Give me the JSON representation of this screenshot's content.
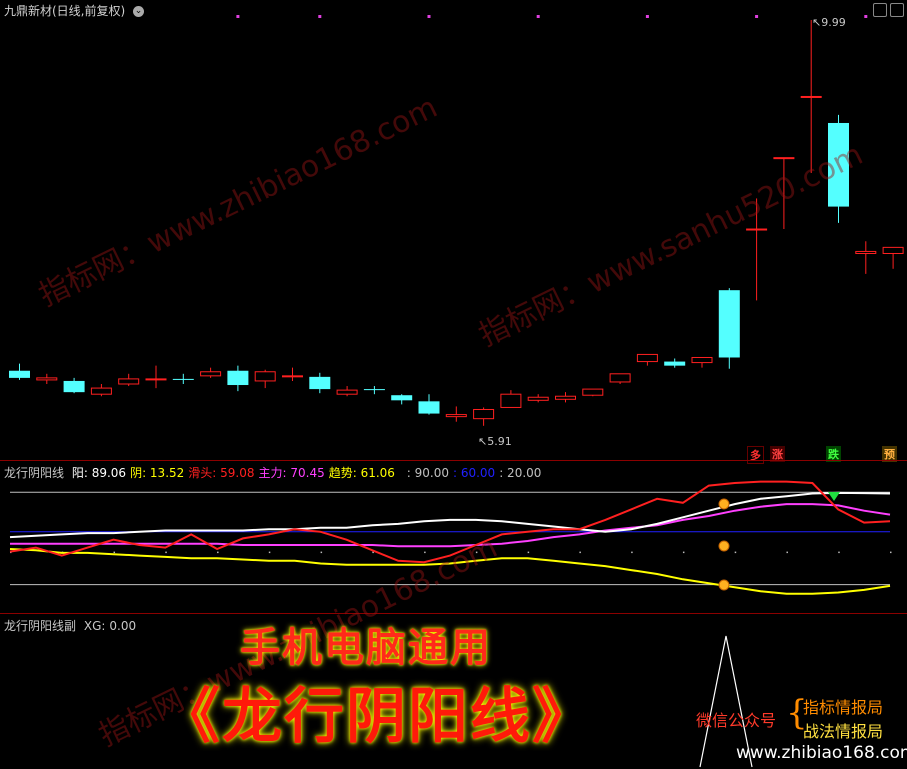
{
  "main": {
    "title": "九鼎新材(日线,前复权)",
    "high_label": "9.99",
    "low_label": "5.91",
    "tags": [
      "多",
      "涨",
      "跌",
      "预"
    ],
    "candles": [
      [
        6.55,
        6.62,
        6.48,
        6.46
      ],
      [
        6.46,
        6.52,
        6.48,
        6.42
      ],
      [
        6.45,
        6.48,
        6.34,
        6.33
      ],
      [
        6.32,
        6.42,
        6.38,
        6.3
      ],
      [
        6.42,
        6.52,
        6.47,
        6.4
      ],
      [
        6.47,
        6.6,
        6.47,
        6.38
      ],
      [
        6.47,
        6.52,
        6.46,
        6.42
      ],
      [
        6.5,
        6.58,
        6.54,
        6.48
      ],
      [
        6.55,
        6.6,
        6.41,
        6.35
      ],
      [
        6.45,
        6.56,
        6.54,
        6.38
      ],
      [
        6.5,
        6.58,
        6.5,
        6.45
      ],
      [
        6.49,
        6.53,
        6.37,
        6.33
      ],
      [
        6.32,
        6.4,
        6.36,
        6.3
      ],
      [
        6.37,
        6.4,
        6.36,
        6.32
      ],
      [
        6.31,
        6.32,
        6.26,
        6.22
      ],
      [
        6.25,
        6.32,
        6.13,
        6.12
      ],
      [
        6.1,
        6.2,
        6.12,
        6.05
      ],
      [
        6.08,
        6.19,
        6.17,
        6.01
      ],
      [
        6.19,
        6.36,
        6.32,
        6.2
      ],
      [
        6.26,
        6.32,
        6.29,
        6.24
      ],
      [
        6.27,
        6.34,
        6.3,
        6.24
      ],
      [
        6.31,
        6.37,
        6.37,
        6.3
      ],
      [
        6.44,
        6.52,
        6.52,
        6.42
      ],
      [
        6.64,
        6.66,
        6.71,
        6.6
      ],
      [
        6.64,
        6.67,
        6.6,
        6.58
      ],
      [
        6.63,
        6.67,
        6.68,
        6.58
      ],
      [
        7.34,
        7.36,
        6.68,
        6.57
      ],
      [
        7.94,
        8.24,
        7.94,
        7.24
      ],
      [
        8.64,
        8.63,
        8.64,
        7.94
      ],
      [
        9.24,
        9.99,
        9.24,
        8.49
      ],
      [
        8.98,
        9.06,
        8.16,
        8.0
      ],
      [
        7.7,
        7.82,
        7.72,
        7.5
      ],
      [
        7.7,
        7.76,
        7.76,
        7.55
      ]
    ]
  },
  "osc": {
    "indicator": "龙行阴阳线",
    "labels": [
      {
        "name": "阳",
        "value": "89.06",
        "color": "#ffffff"
      },
      {
        "name": "阴",
        "value": "13.52",
        "color": "#ffff00"
      },
      {
        "name": "滑头",
        "value": "59.08",
        "color": "#ff2020"
      },
      {
        "name": "主力",
        "value": "70.45",
        "color": "#ff40ff"
      },
      {
        "name": "趋势",
        "value": "61.06",
        "color": "#ffff00"
      }
    ],
    "levels": [
      {
        "value": "90.00",
        "color": "#c0c0c0"
      },
      {
        "value": "60.00",
        "color": "#2020ff"
      },
      {
        "value": "20.00",
        "color": "#c0c0c0"
      }
    ],
    "yang": [
      56,
      57,
      58,
      59,
      59,
      60,
      61,
      61,
      61,
      61,
      62,
      62,
      63,
      63,
      65,
      66,
      68,
      69,
      69,
      68,
      66,
      64,
      62,
      60,
      62,
      66,
      71,
      76,
      81,
      85,
      87,
      89,
      89.5,
      89.3,
      89
    ],
    "yin": [
      47,
      46,
      44,
      44,
      43,
      42,
      41,
      40,
      40,
      39,
      38,
      38,
      36,
      35,
      35,
      35,
      35,
      36,
      38,
      40,
      40,
      38,
      36,
      34,
      31,
      28,
      24,
      21,
      18,
      15,
      13,
      13,
      14,
      16,
      19
    ],
    "hua": [
      45,
      48,
      42,
      48,
      54,
      50,
      48,
      58,
      47,
      55,
      58,
      62,
      60,
      54,
      46,
      38,
      37,
      42,
      50,
      58,
      60,
      62,
      62,
      69,
      77,
      85,
      82,
      95,
      97,
      98,
      98,
      97,
      77,
      67,
      68
    ],
    "zhu": [
      51,
      51,
      51,
      51,
      51,
      51,
      51,
      51,
      51,
      50,
      50,
      50,
      50,
      50,
      50,
      49,
      49,
      49,
      50,
      51,
      53,
      56,
      58,
      61,
      63,
      65,
      69,
      72,
      76,
      79,
      81,
      81,
      80,
      76,
      73
    ]
  },
  "sub": {
    "indicator": "龙行阴阳线副",
    "xg_label": "XG:",
    "xg_value": "0.00"
  },
  "promo": {
    "line1": "手机电脑通用",
    "line2": "《龙行阴阳线》",
    "wechat": "微信公众号",
    "brace": "{",
    "name1": "指标情报局",
    "name2": "战法情报局",
    "site": "www.zhibiao168.com"
  },
  "watermarks": [
    "指标网：www.zhibiao168.com",
    "指标网：www.sanhu520.com",
    "指标网：www.zhibiao168.com"
  ],
  "colors": {
    "up": "#ff2020",
    "down": "#54ffff",
    "bg": "#000000",
    "sep": "#8b0000"
  }
}
